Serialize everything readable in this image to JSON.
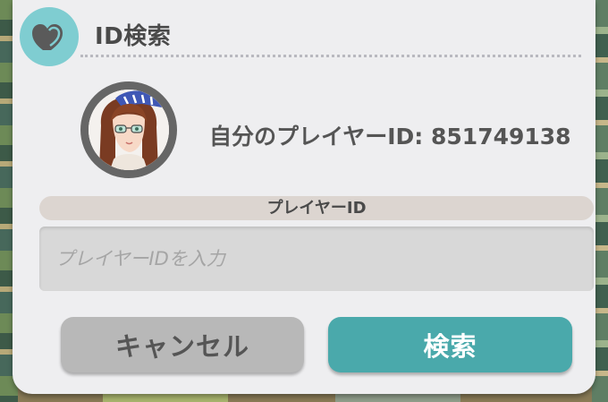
{
  "dialog": {
    "title": "ID検索",
    "header_icon": "heart-badge-icon",
    "accent_color": "#7fcdd1"
  },
  "profile": {
    "player_id_line": "自分のプレイヤーID: 851749138",
    "avatar": "player-avatar-portrait"
  },
  "search_field": {
    "label": "プレイヤーID",
    "value": "",
    "placeholder": "プレイヤーIDを入力"
  },
  "buttons": {
    "cancel_label": "キャンセル",
    "search_label": "検索",
    "search_color": "#4aa9ab",
    "cancel_color": "#b8b8b8"
  }
}
